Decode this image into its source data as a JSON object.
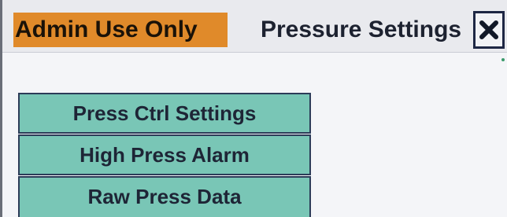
{
  "header": {
    "admin_label": "Admin Use Only",
    "title": "Pressure Settings",
    "close_icon": "close-x-icon"
  },
  "menu": {
    "items": [
      {
        "label": "Press Ctrl Settings"
      },
      {
        "label": "High Press Alarm"
      },
      {
        "label": "Raw Press Data"
      }
    ]
  },
  "colors": {
    "admin_badge": "#e08a2a",
    "menu_button": "#79c6b6",
    "background": "#f4f5f8",
    "text": "#1d2230"
  }
}
